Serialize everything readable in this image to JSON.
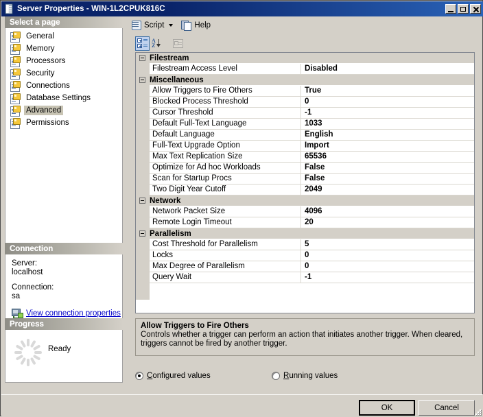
{
  "window": {
    "title": "Server Properties - WIN-1L2CPUK816C",
    "icon": "server-icon",
    "buttons": {
      "minimize": "_",
      "maximize": "□",
      "close": "✕"
    }
  },
  "toolbar": {
    "script_label": "Script",
    "script_icon": "script-icon",
    "dropdown_icon": "chevron-down-icon",
    "help_label": "Help",
    "help_icon": "help-icon"
  },
  "grid_toolbar": {
    "categorized_icon": "categorized-view-icon",
    "alphabetical_icon": "alphabetical-sort-icon",
    "property_pages_icon": "property-pages-icon"
  },
  "sidebar": {
    "header": "Select a page",
    "items": [
      {
        "label": "General",
        "selected": false
      },
      {
        "label": "Memory",
        "selected": false
      },
      {
        "label": "Processors",
        "selected": false
      },
      {
        "label": "Security",
        "selected": false
      },
      {
        "label": "Connections",
        "selected": false
      },
      {
        "label": "Database Settings",
        "selected": false
      },
      {
        "label": "Advanced",
        "selected": true
      },
      {
        "label": "Permissions",
        "selected": false
      }
    ]
  },
  "connection": {
    "header": "Connection",
    "server_label": "Server:",
    "server_value": "localhost",
    "connection_label": "Connection:",
    "connection_value": "sa",
    "link_text": "View connection properties",
    "link_icon": "server-connection-icon"
  },
  "progress": {
    "header": "Progress",
    "status": "Ready",
    "spinner_icon": "progress-spinner-icon"
  },
  "property_grid": {
    "groups": [
      {
        "name": "Filestream",
        "rows": [
          {
            "name": "Filestream Access Level",
            "value": "Disabled"
          }
        ]
      },
      {
        "name": "Miscellaneous",
        "rows": [
          {
            "name": "Allow Triggers to Fire Others",
            "value": "True"
          },
          {
            "name": "Blocked Process Threshold",
            "value": "0"
          },
          {
            "name": "Cursor Threshold",
            "value": "-1"
          },
          {
            "name": "Default Full-Text Language",
            "value": "1033"
          },
          {
            "name": "Default Language",
            "value": "English"
          },
          {
            "name": "Full-Text Upgrade Option",
            "value": "Import"
          },
          {
            "name": "Max Text Replication Size",
            "value": "65536"
          },
          {
            "name": "Optimize for Ad hoc Workloads",
            "value": "False"
          },
          {
            "name": "Scan for Startup Procs",
            "value": "False"
          },
          {
            "name": "Two Digit Year Cutoff",
            "value": "2049"
          }
        ]
      },
      {
        "name": "Network",
        "rows": [
          {
            "name": "Network Packet Size",
            "value": "4096"
          },
          {
            "name": "Remote Login Timeout",
            "value": "20"
          }
        ]
      },
      {
        "name": "Parallelism",
        "rows": [
          {
            "name": "Cost Threshold for Parallelism",
            "value": "5"
          },
          {
            "name": "Locks",
            "value": "0"
          },
          {
            "name": "Max Degree of Parallelism",
            "value": "0"
          },
          {
            "name": "Query Wait",
            "value": "-1"
          }
        ]
      }
    ]
  },
  "description": {
    "title": "Allow Triggers to Fire Others",
    "text": "Controls whether a trigger can perform an action that initiates another trigger. When cleared, triggers cannot be fired by another trigger."
  },
  "value_mode": {
    "configured": {
      "label": "Configured values",
      "accel": "C",
      "selected": true
    },
    "running": {
      "label": "Running values",
      "accel": "R",
      "selected": false
    }
  },
  "footer": {
    "ok_label": "OK",
    "cancel_label": "Cancel"
  }
}
